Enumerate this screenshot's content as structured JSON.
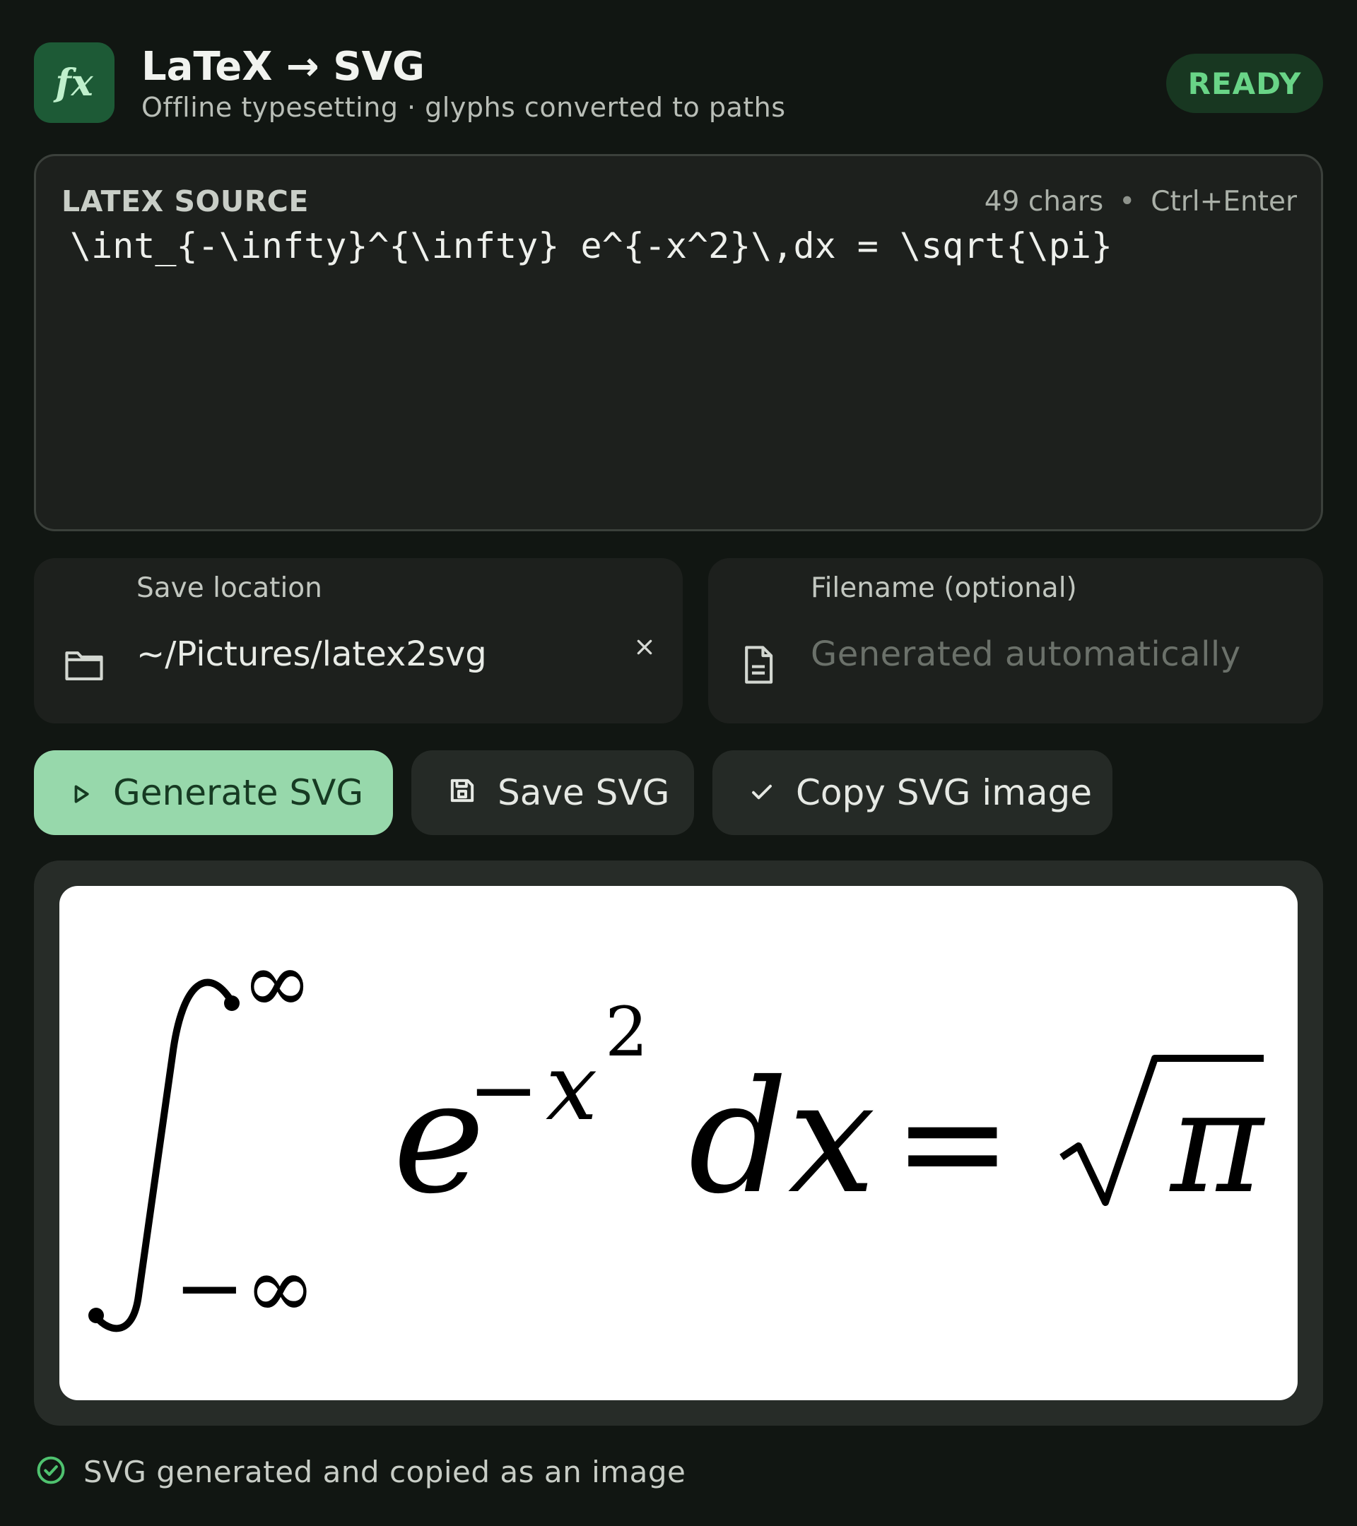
{
  "header": {
    "icon_label": "fx",
    "title": "LaTeX → SVG",
    "subtitle": "Offline typesetting · glyphs converted to paths",
    "status": "READY"
  },
  "source": {
    "label": "LATEX SOURCE",
    "char_count": "49 chars",
    "shortcut": "Ctrl+Enter",
    "value": "\\int_{-\\infty}^{\\infty} e^{-x^2}\\,dx = \\sqrt{\\pi}"
  },
  "save_location": {
    "label": "Save location",
    "value": "~/Pictures/latex2svg"
  },
  "filename": {
    "label": "Filename (optional)",
    "placeholder": "Generated automatically"
  },
  "buttons": {
    "generate": "Generate SVG",
    "save": "Save SVG",
    "copy": "Copy SVG image"
  },
  "preview": {
    "upper_limit": "∞",
    "lower_limit": "−∞",
    "base": "e",
    "exponent_sign": "−",
    "exponent_var": "x",
    "exponent_power": "2",
    "differential": "dx",
    "equals": "=",
    "radicand": "π"
  },
  "status": {
    "message": "SVG generated and copied as an image"
  },
  "colors": {
    "accent": "#97d8ab",
    "ready": "#69d487",
    "background": "#111612"
  }
}
